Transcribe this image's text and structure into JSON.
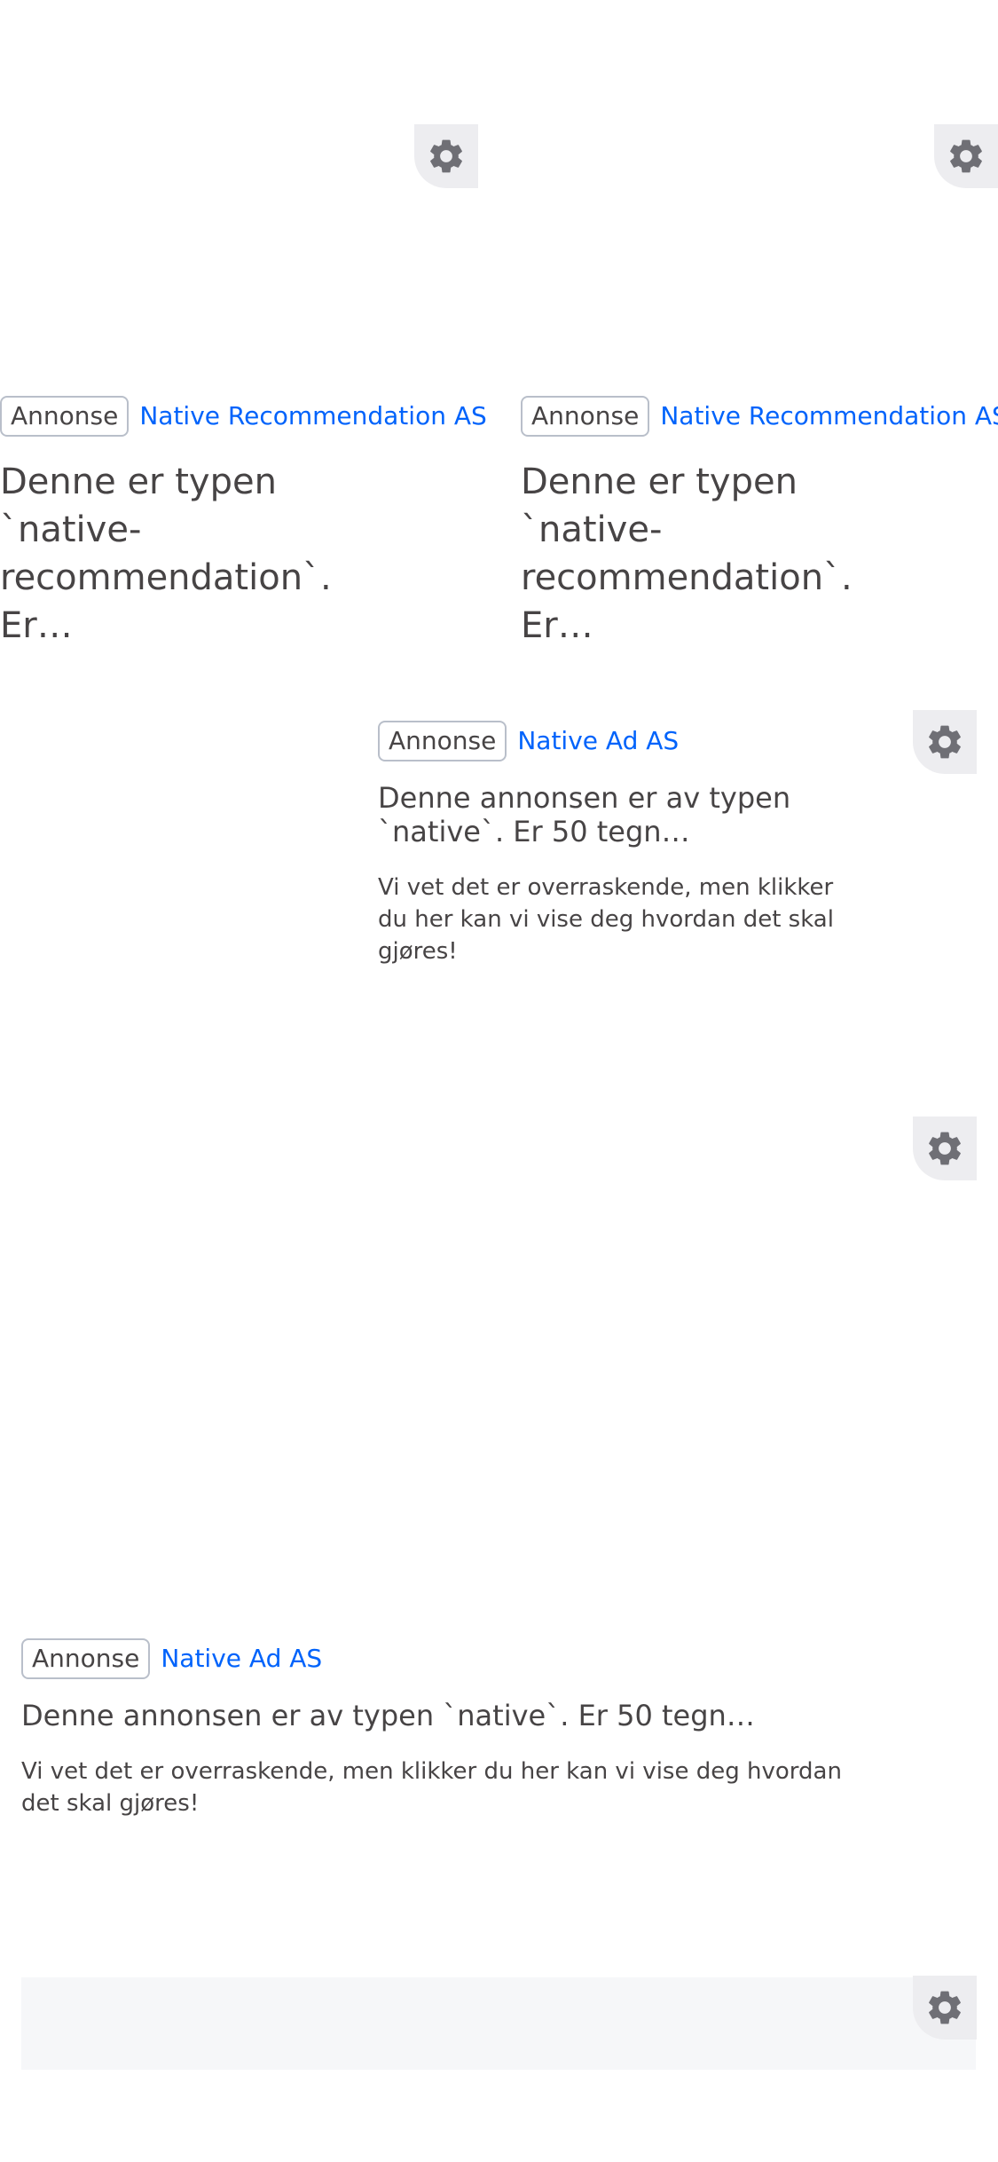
{
  "icons": {
    "settings": "gear-icon"
  },
  "colors": {
    "advertiser_link": "#0063fb",
    "text": "#474445",
    "badge_border": "#b9bfca",
    "gear_background": "#ededf0",
    "gear_icon": "#6f6f75",
    "placeholder_panel": "#f6f7f9"
  },
  "recommendation_ads": [
    {
      "badge": "Annonse",
      "advertiser": "Native Recommendation AS",
      "title": "Denne er typen `native-recommendation`. Er…"
    },
    {
      "badge": "Annonse",
      "advertiser": "Native Recommendation AS",
      "title": "Denne er typen `native-recommendation`. Er…"
    }
  ],
  "native_ads": [
    {
      "badge": "Annonse",
      "advertiser": "Native Ad AS",
      "title": "Denne annonsen er av typen `native`. Er 50 tegn…",
      "body": "Vi vet det er overraskende, men klikker du her kan vi vise deg hvordan det skal gjøres!"
    },
    {
      "badge": "Annonse",
      "advertiser": "Native Ad AS",
      "title": "Denne annonsen er av typen `native`. Er 50 tegn…",
      "body": "Vi vet det er overraskende, men klikker du her kan vi vise deg hvordan det skal gjøres!"
    }
  ]
}
